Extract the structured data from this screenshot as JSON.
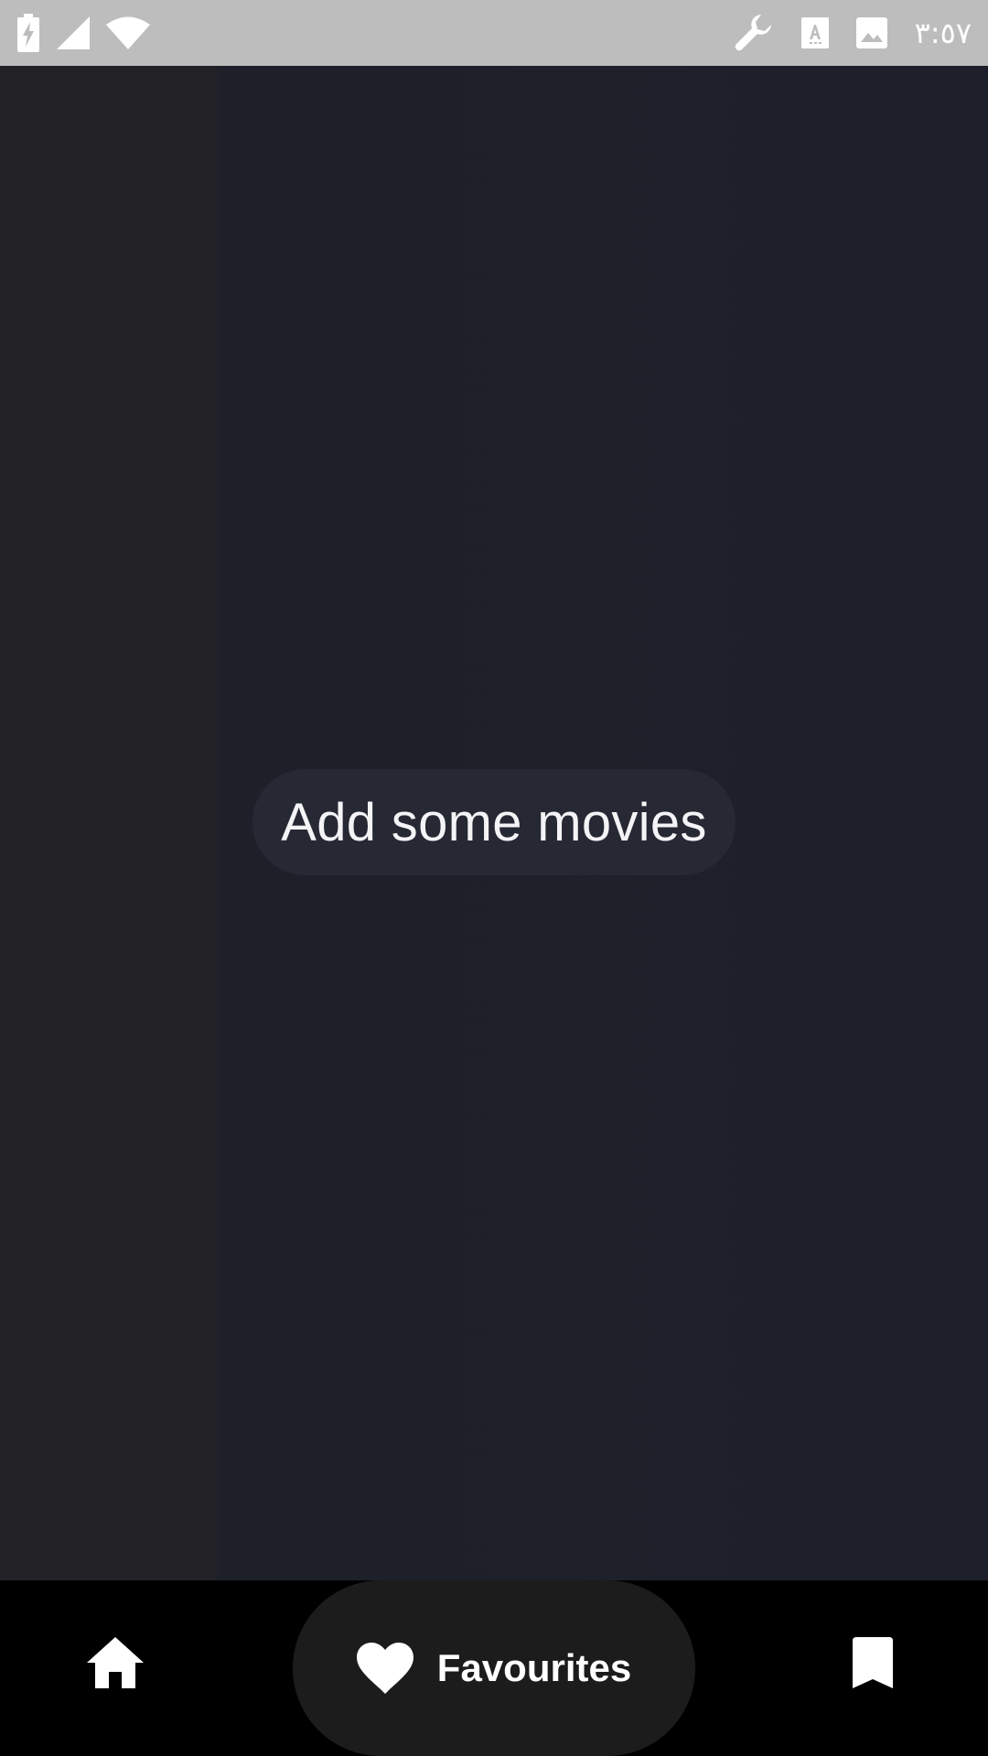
{
  "status_bar": {
    "time": "٣:٥٧",
    "left_icons": [
      "battery-charging-icon",
      "cellular-signal-icon",
      "wifi-icon"
    ],
    "right_icons": [
      "wrench-icon",
      "text-recognition-icon",
      "image-icon"
    ]
  },
  "main": {
    "empty_message": "Add some movies"
  },
  "bottom_nav": {
    "items": [
      {
        "name": "home",
        "icon": "home-icon",
        "label": "",
        "active": false
      },
      {
        "name": "favourites",
        "icon": "heart-icon",
        "label": "Favourites",
        "active": true
      },
      {
        "name": "bookmarks",
        "icon": "bookmark-icon",
        "label": "",
        "active": false
      }
    ]
  },
  "colors": {
    "status_bar_bg": "#bdbdbd",
    "content_bg": "#1f2029",
    "pill_bg": "#262834",
    "nav_bg": "#000000",
    "active_nav_bg": "#1c1c1c",
    "foreground": "#ffffff"
  }
}
